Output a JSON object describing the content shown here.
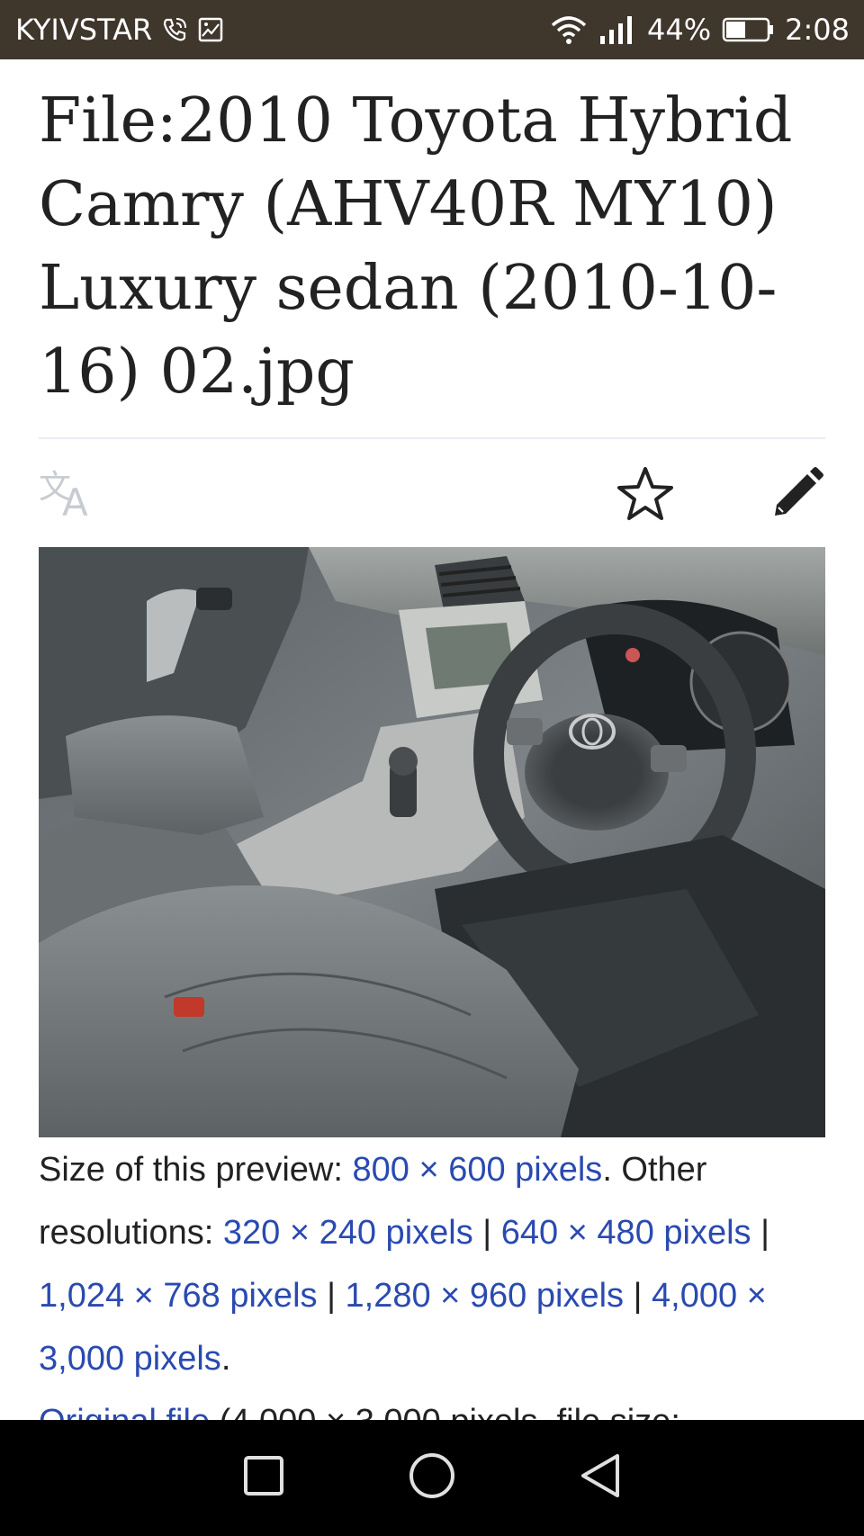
{
  "status_bar": {
    "carrier": "KYIVSTAR",
    "battery": "44%",
    "time": "2:08"
  },
  "page": {
    "title": "File:2010 Toyota Hybrid Camry (AHV40R MY10) Luxury sedan (2010-10-16) 02.jpg"
  },
  "toolbar": {
    "language_icon": "translate-icon",
    "watch_icon": "star-icon",
    "edit_icon": "pencil-icon"
  },
  "image": {
    "description_icon": "car-interior-photo"
  },
  "file_info": {
    "size_prefix": "Size of this preview: ",
    "preview_link": "800 × 600 pixels",
    "other_prefix": ". Other resolutions: ",
    "res1": "320 × 240 pixels",
    "sep": " | ",
    "res2": "640 × 480 pixels",
    "res3": "1,024 × 768 pixels",
    "res4": "1,280 × 960 pixels",
    "res5": "4,000 × 3,000 pixels",
    "end": ".",
    "original_link": "Original file",
    "original_suffix": " (4,000 × 3,000 pixels, file size:"
  },
  "nav_bar": {
    "recents_icon": "square-icon",
    "home_icon": "circle-icon",
    "back_icon": "triangle-back-icon"
  },
  "colors": {
    "status_bar": "#3f362c",
    "link": "#2a4ab0",
    "nav_bar": "#000000"
  }
}
